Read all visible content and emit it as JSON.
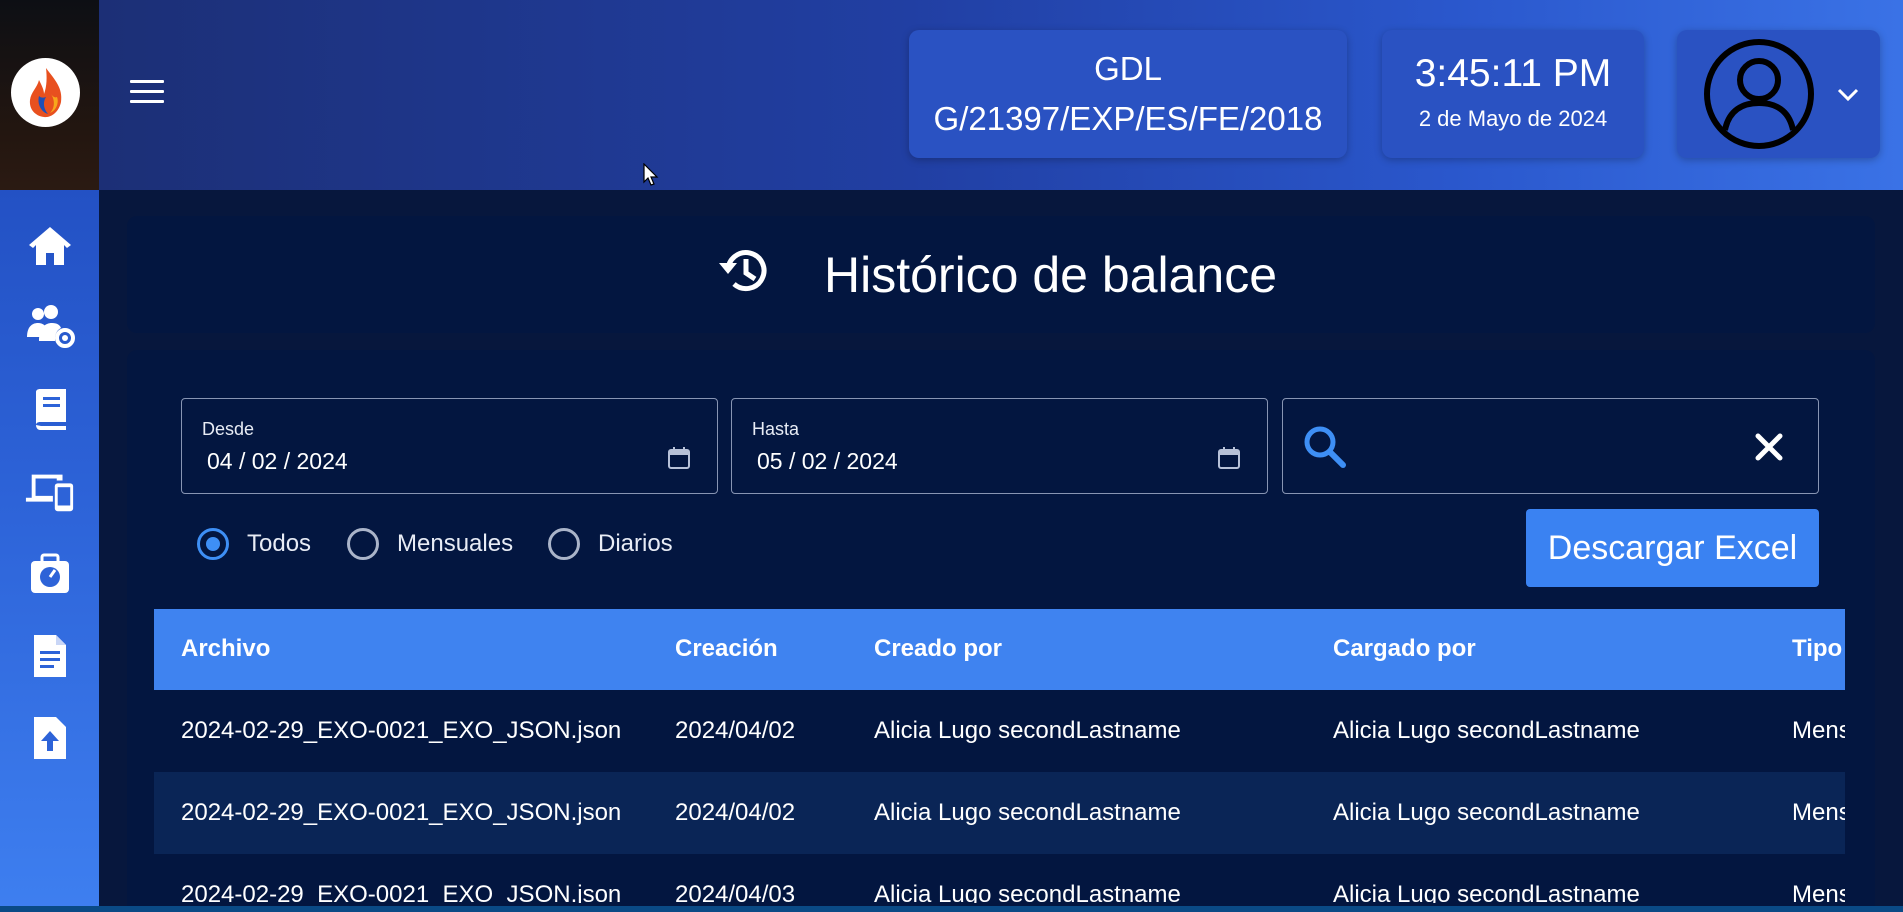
{
  "header": {
    "site_code": "GDL",
    "permit": "G/21397/EXP/ES/FE/2018",
    "time": "3:45:11 PM",
    "date": "2 de Mayo de 2024"
  },
  "sidebar": {
    "items": [
      {
        "icon": "home-icon"
      },
      {
        "icon": "users-settings-icon"
      },
      {
        "icon": "book-icon"
      },
      {
        "icon": "devices-icon"
      },
      {
        "icon": "gauge-icon"
      },
      {
        "icon": "document-list-icon"
      },
      {
        "icon": "file-upload-icon"
      }
    ]
  },
  "page": {
    "title": "Histórico de balance"
  },
  "filters": {
    "from_label": "Desde",
    "from_value": "04 / 02 / 2024",
    "to_label": "Hasta",
    "to_value": "05 / 02 / 2024",
    "search_value": "",
    "radio": [
      "Todos",
      "Mensuales",
      "Diarios"
    ],
    "selected": "Todos",
    "download_label": "Descargar Excel"
  },
  "table": {
    "columns": [
      "Archivo",
      "Creación",
      "Creado por",
      "Cargado por",
      "Tipo"
    ],
    "rows": [
      [
        "2024-02-29_EXO-0021_EXO_JSON.json",
        "2024/04/02",
        "Alicia Lugo secondLastname",
        "Alicia Lugo secondLastname",
        "Mensual"
      ],
      [
        "2024-02-29_EXO-0021_EXO_JSON.json",
        "2024/04/02",
        "Alicia Lugo secondLastname",
        "Alicia Lugo secondLastname",
        "Mensual"
      ],
      [
        "2024-02-29_EXO-0021_EXO_JSON.json",
        "2024/04/03",
        "Alicia Lugo secondLastname",
        "Alicia Lugo secondLastname",
        "Mensual"
      ]
    ]
  },
  "colors": {
    "accent": "#3f83f0",
    "panel": "#031640",
    "header_card": "#2a52c2"
  }
}
